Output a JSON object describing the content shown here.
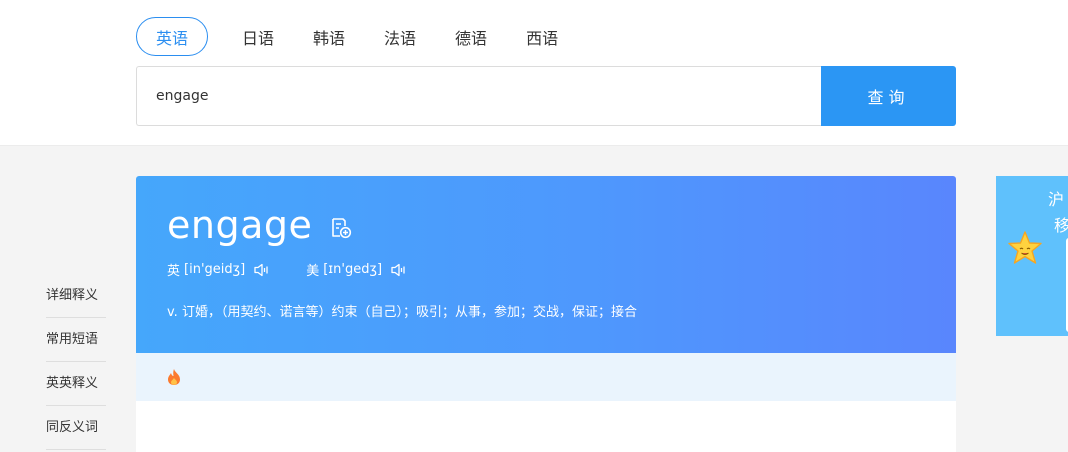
{
  "tabs": [
    {
      "label": "英语",
      "active": true
    },
    {
      "label": "日语",
      "active": false
    },
    {
      "label": "韩语",
      "active": false
    },
    {
      "label": "法语",
      "active": false
    },
    {
      "label": "德语",
      "active": false
    },
    {
      "label": "西语",
      "active": false
    }
  ],
  "search": {
    "value": "engage",
    "button_label": "查询"
  },
  "side_nav": {
    "items": [
      "详细释义",
      "常用短语",
      "英英释义",
      "同反义词"
    ]
  },
  "entry": {
    "word": "engage",
    "uk_label": "英",
    "uk_phonetic": "[in'geidʒ]",
    "us_label": "美",
    "us_phonetic": "[ɪn'gedʒ]",
    "definition": "v. 订婚，（用契约、诺言等）约束（自己）；吸引；从事，参加；交战，保证；接合"
  },
  "promo": {
    "line1": "沪",
    "line2": "移"
  },
  "icons": {
    "add_to_notebook": "notebook-add-icon",
    "pronounce": "speaker-icon",
    "hot": "fire-icon",
    "mascot": "star-icon"
  },
  "colors": {
    "accent": "#2b96f4",
    "header_gradient_start": "#45a7fb",
    "header_gradient_end": "#5986fd",
    "sub_bar": "#eaf4fd",
    "promo_bg": "#5fc1fc"
  }
}
